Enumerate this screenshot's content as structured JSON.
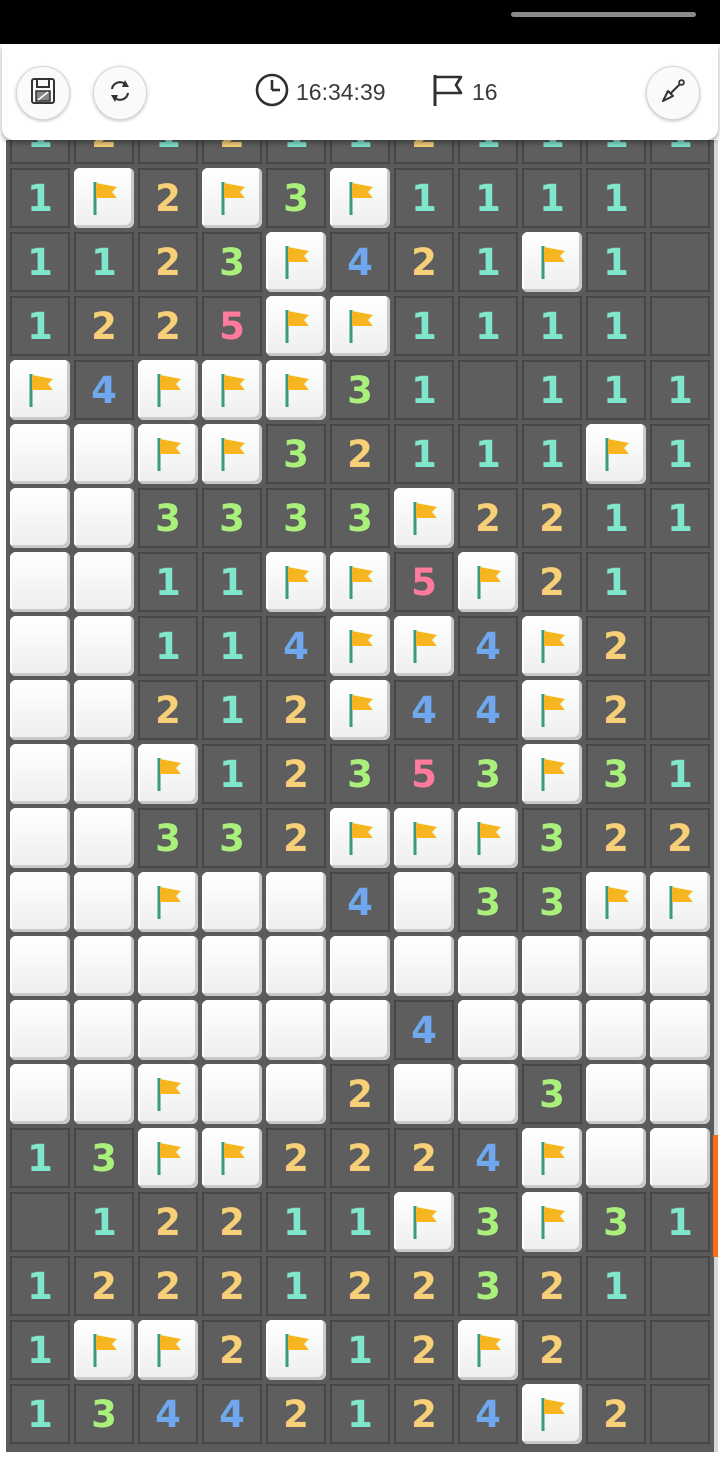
{
  "toolbar": {
    "timer": "16:34:39",
    "flags": "16",
    "icons": [
      "save-icon",
      "restart-icon",
      "clock-icon",
      "flag-count-icon",
      "shovel-icon"
    ]
  },
  "colors": {
    "n1": "#7fe6cc",
    "n2": "#f6cf78",
    "n3": "#aaf07a",
    "n4": "#6fa8f0",
    "n5": "#ff7a9c",
    "flag": "#f7b521",
    "scroll_indicator": "#ff6a1a"
  },
  "legend": "Cell codes: '1'-'8' revealed number, 'o' revealed empty, 'F' flagged, '.' covered",
  "partial_top_row": "12121121111",
  "board": [
    "1F2F3F1111o",
    "1123F421F1o",
    "1225FF1111o",
    "F4FFF31o111",
    "..FF32111F1",
    "..3333F2211",
    "..11FF5F21o",
    "..114FF4F2o",
    "..212F44F2o",
    "..F12353F31o",
    "..332FFF322",
    "..F..4.33FF",
    "...........",
    "......4....",
    "..F..2..3..",
    "13FF2224F..",
    "o12211F3F31",
    "1222122321o",
    "1FF2F12F2oo",
    "13442124F2oo"
  ]
}
